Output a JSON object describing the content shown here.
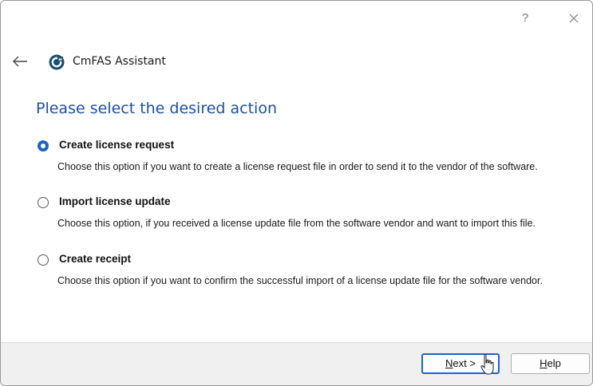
{
  "titlebar": {
    "help_glyph": "?",
    "close_icon": "close-icon"
  },
  "nav": {
    "back_icon": "back-arrow-icon",
    "app_name": "CmFAS Assistant"
  },
  "main": {
    "heading": "Please select the desired action",
    "options": [
      {
        "label": "Create license request",
        "description": "Choose this option if you want to create a license request file in order to send it to the vendor of the software.",
        "selected": true
      },
      {
        "label": "Import license update",
        "description": "Choose this option, if you received a license update file from the software vendor and want to import this file.",
        "selected": false
      },
      {
        "label": "Create receipt",
        "description": "Choose this option if you want to confirm the successful import of a license update file for the software vendor.",
        "selected": false
      }
    ]
  },
  "footer": {
    "next": {
      "mnemonic": "N",
      "rest": "ext >"
    },
    "help": {
      "mnemonic": "H",
      "rest": "elp"
    }
  },
  "colors": {
    "accent": "#1f63c9",
    "heading": "#1d4fa6",
    "logo": "#1b4f6b"
  }
}
